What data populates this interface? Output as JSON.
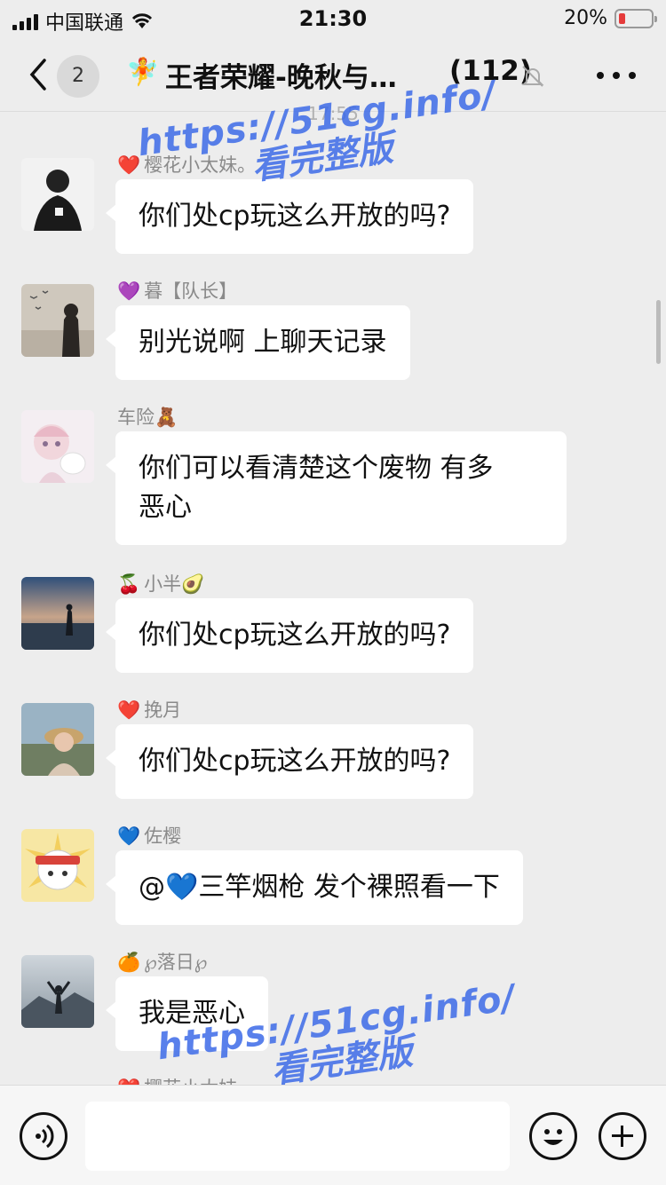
{
  "status_bar": {
    "carrier": "中国联通",
    "time": "21:30",
    "battery_percent": "20%",
    "battery_level": 0.2
  },
  "nav": {
    "unread_count": "2",
    "title_icon": "🧚",
    "title": "王者荣耀-晚秋与…",
    "member_count": "(112)"
  },
  "timestamp": "17:55",
  "messages": [
    {
      "sender_emoji": "❤️",
      "sender": "樱花小太妹。",
      "text": "你们处cp玩这么开放的吗?"
    },
    {
      "sender_emoji": "💜",
      "sender": "暮【队长】",
      "text": "别光说啊 上聊天记录"
    },
    {
      "sender_emoji": "",
      "sender": "车险🧸",
      "text_line1": "你们可以看清楚这个废物 有多",
      "text_line2": "恶心"
    },
    {
      "sender_emoji": "🍒",
      "sender": "小半🥑",
      "text": "你们处cp玩这么开放的吗?"
    },
    {
      "sender_emoji": "❤️",
      "sender": "挽月",
      "text": "你们处cp玩这么开放的吗?"
    },
    {
      "sender_emoji": "💙",
      "sender": "佐樱",
      "text": "@💙三竿烟枪 发个裸照看一下"
    },
    {
      "sender_emoji": "🍊",
      "sender": "℘落日℘",
      "text": "我是恶心"
    },
    {
      "sender_emoji": "❤️",
      "sender": "樱花小太妹"
    }
  ],
  "watermark": {
    "url": "https://51cg.info/",
    "label": "看完整版"
  },
  "colors": {
    "background": "#ededed",
    "bubble": "#ffffff",
    "watermark": "#3d6be8",
    "battery_low": "#e53b3b"
  }
}
